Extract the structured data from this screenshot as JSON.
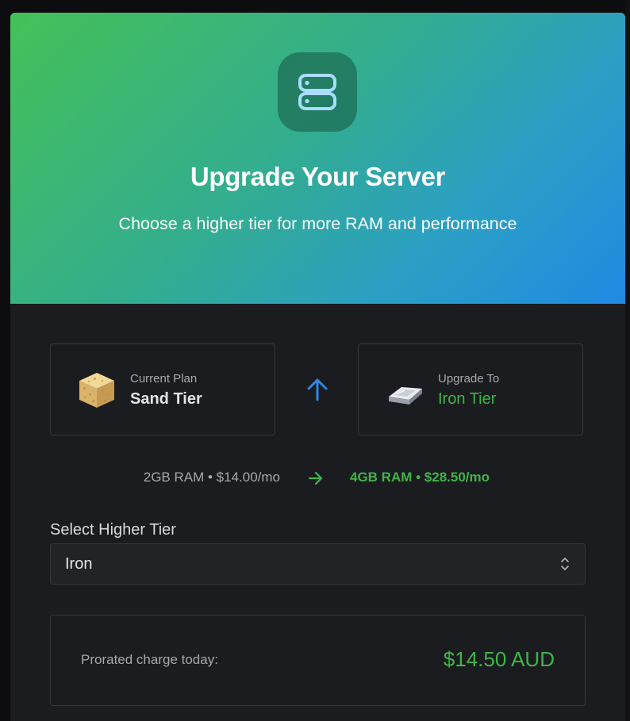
{
  "hero": {
    "icon": "server-icon",
    "title": "Upgrade Your Server",
    "subtitle": "Choose a higher tier for more RAM and performance"
  },
  "current_plan": {
    "label": "Current Plan",
    "name": "Sand Tier",
    "icon": "sand-block-icon",
    "specs": "2GB RAM • $14.00/mo"
  },
  "upgrade_plan": {
    "label": "Upgrade To",
    "name": "Iron Tier",
    "icon": "iron-ingot-icon",
    "specs": "4GB RAM • $28.50/mo"
  },
  "tier_select": {
    "label": "Select Higher Tier",
    "value": "Iron"
  },
  "charge": {
    "label": "Prorated charge today:",
    "amount": "$14.50 AUD"
  },
  "colors": {
    "accent_green": "#3fb549",
    "accent_blue": "#2b8ae6",
    "hero_gradient_start": "#45c158",
    "hero_gradient_end": "#208ae4",
    "modal_background": "#1b1c20"
  }
}
